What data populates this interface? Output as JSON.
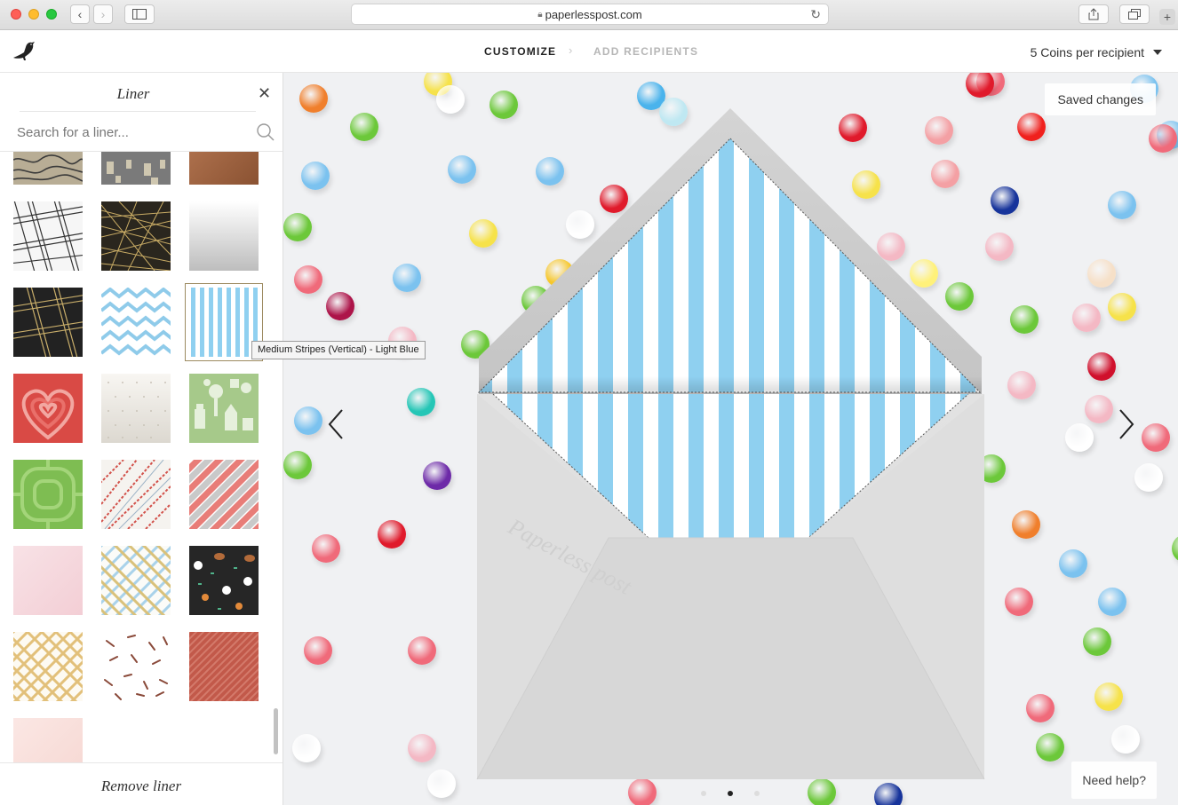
{
  "browser": {
    "url": "paperlesspost.com"
  },
  "header": {
    "steps": [
      "CUSTOMIZE",
      "ADD RECIPIENTS"
    ],
    "step_separator": "›",
    "coins_label": "5 Coins per recipient"
  },
  "sidebar": {
    "title": "Liner",
    "search_placeholder": "Search for a liner...",
    "remove_label": "Remove liner",
    "tooltip": "Medium Stripes (Vertical) - Light Blue",
    "selected_swatch": "Medium Stripes (Vertical) - Light Blue"
  },
  "canvas": {
    "saved_label": "Saved changes",
    "help_label": "Need help?",
    "envelope_watermark": "Paperless post",
    "pager": {
      "count": 3,
      "active": 1
    },
    "liner_colors": {
      "stripe": "#8fd0f0",
      "base": "#ffffff"
    }
  }
}
